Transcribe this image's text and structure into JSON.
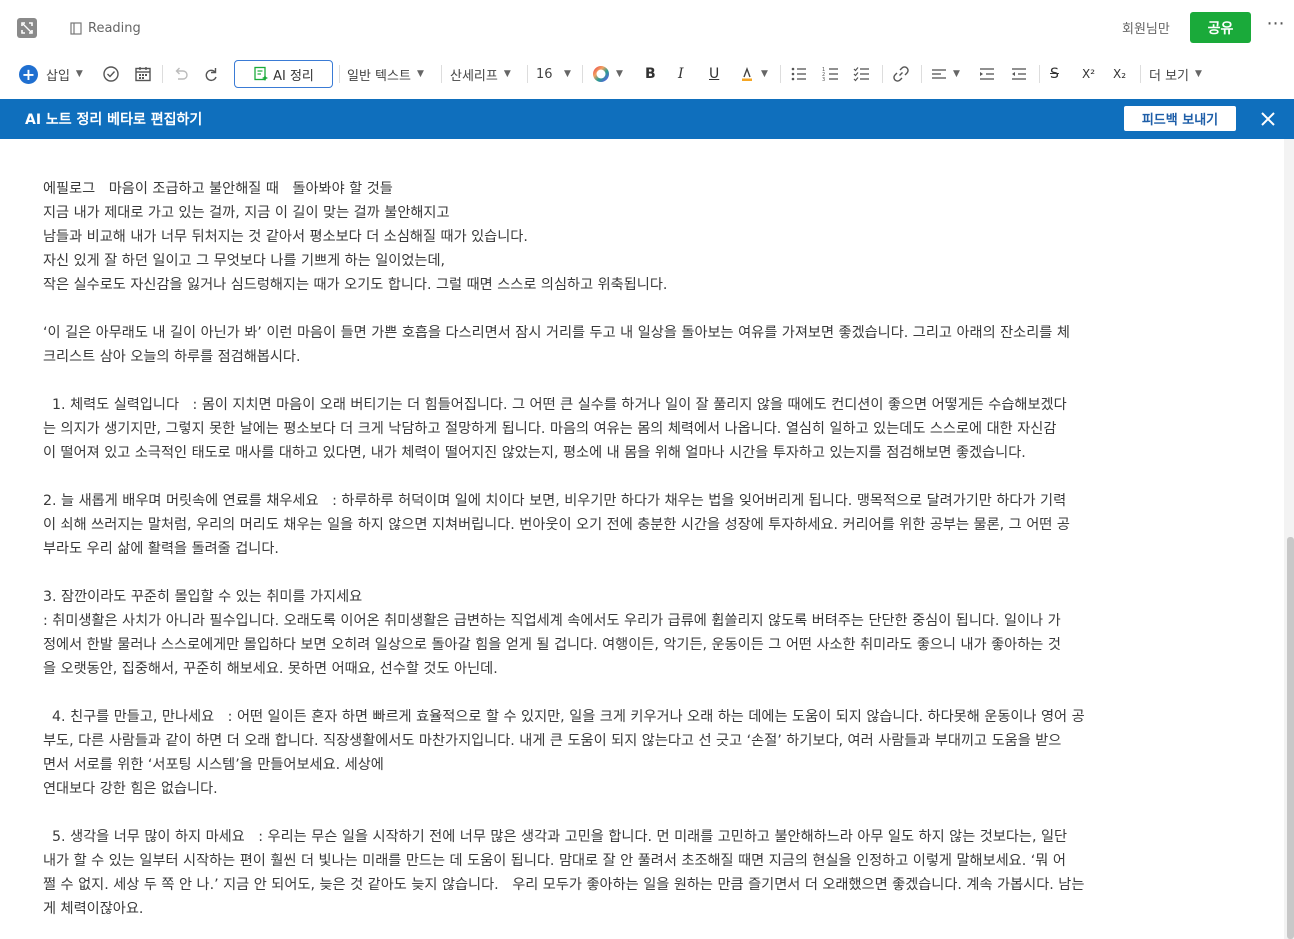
{
  "titlebar": {
    "title": "Reading",
    "members_label": "회원님만",
    "share_label": "공유",
    "more_label": "⋯"
  },
  "toolbar": {
    "insert_label": "삽입",
    "ai_label": "AI 정리",
    "text_style": "일반 텍스트",
    "font": "산세리프",
    "font_size": "16",
    "bold": "B",
    "italic": "I",
    "underline": "U",
    "strikethrough": "S",
    "superscript": "X²",
    "subscript": "X₂",
    "more_label": "더 보기",
    "accent_color": "#1f6fd0"
  },
  "banner": {
    "title": "AI 노트 정리 베타로 편집하기",
    "feedback_label": "피드백 보내기",
    "background_color": "#0f6fbd"
  },
  "content": {
    "lines": [
      "에필로그   마음이 조급하고 불안해질 때   돌아봐야 할 것들",
      "지금 내가 제대로 가고 있는 걸까, 지금 이 길이 맞는 걸까 불안해지고",
      "남들과 비교해 내가 너무 뒤처지는 것 같아서 평소보다 더 소심해질 때가 있습니다.",
      "자신 있게 잘 하던 일이고 그 무엇보다 나를 기쁘게 하는 일이었는데,",
      "작은 실수로도 자신감을 잃거나 심드렁해지는 때가 오기도 합니다. 그럴 때면 스스로 의심하고 위축됩니다.",
      "‘이 길은 아무래도 내 길이 아닌가 봐’ 이런 마음이 들면 가쁜 호흡을 다스리면서 잠시 거리를 두고 내 일상을 돌아보는 여유를 가져보면 좋겠습니다. 그리고 아래의 잔소리를 체",
      "크리스트 삼아 오늘의 하루를 점검해봅시다.",
      "  1. 체력도 실력입니다   : 몸이 지치면 마음이 오래 버티기는 더 힘들어집니다. 그 어떤 큰 실수를 하거나 일이 잘 풀리지 않을 때에도 컨디션이 좋으면 어떻게든 수습해보겠다",
      "는 의지가 생기지만, 그렇지 못한 날에는 평소보다 더 크게 낙담하고 절망하게 됩니다. 마음의 여유는 몸의 체력에서 나옵니다. 열심히 일하고 있는데도 스스로에 대한 자신감",
      "이 떨어져 있고 소극적인 태도로 매사를 대하고 있다면, 내가 체력이 떨어지진 않았는지, 평소에 내 몸을 위해 얼마나 시간을 투자하고 있는지를 점검해보면 좋겠습니다.",
      "2. 늘 새롭게 배우며 머릿속에 연료를 채우세요   : 하루하루 허덕이며 일에 치이다 보면, 비우기만 하다가 채우는 법을 잊어버리게 됩니다. 맹목적으로 달려가기만 하다가 기력",
      "이 쇠해 쓰러지는 말처럼, 우리의 머리도 채우는 일을 하지 않으면 지쳐버립니다. 번아웃이 오기 전에 충분한 시간을 성장에 투자하세요. 커리어를 위한 공부는 물론, 그 어떤 공",
      "부라도 우리 삶에 활력을 돌려줄 겁니다.",
      "3. 잠깐이라도 꾸준히 몰입할 수 있는 취미를 가지세요",
      ": 취미생활은 사치가 아니라 필수입니다. 오래도록 이어온 취미생활은 급변하는 직업세계 속에서도 우리가 급류에 휩쓸리지 않도록 버텨주는 단단한 중심이 됩니다. 일이나 가",
      "정에서 한발 물러나 스스로에게만 몰입하다 보면 오히려 일상으로 돌아갈 힘을 얻게 될 겁니다. 여행이든, 악기든, 운동이든 그 어떤 사소한 취미라도 좋으니 내가 좋아하는 것",
      "을 오랫동안, 집중해서, 꾸준히 해보세요. 못하면 어때요, 선수할 것도 아닌데.",
      "  4. 친구를 만들고, 만나세요   : 어떤 일이든 혼자 하면 빠르게 효율적으로 할 수 있지만, 일을 크게 키우거나 오래 하는 데에는 도움이 되지 않습니다. 하다못해 운동이나 영어 공",
      "부도, 다른 사람들과 같이 하면 더 오래 합니다. 직장생활에서도 마찬가지입니다. 내게 큰 도움이 되지 않는다고 선 긋고 ‘손절’ 하기보다, 여러 사람들과 부대끼고 도움을 받으",
      "면서 서로를 위한 ‘서포팅 시스템’을 만들어보세요. 세상에",
      "연대보다 강한 힘은 없습니다.",
      "  5. 생각을 너무 많이 하지 마세요   : 우리는 무슨 일을 시작하기 전에 너무 많은 생각과 고민을 합니다. 먼 미래를 고민하고 불안해하느라 아무 일도 하지 않는 것보다는, 일단",
      "내가 할 수 있는 일부터 시작하는 편이 훨씬 더 빛나는 미래를 만드는 데 도움이 됩니다. 맘대로 잘 안 풀려서 초조해질 때면 지금의 현실을 인정하고 이렇게 말해보세요. ‘뭐 어",
      "쩔 수 없지. 세상 두 쪽 안 나.’ 지금 안 되어도, 늦은 것 같아도 늦지 않습니다.   우리 모두가 좋아하는 일을 원하는 만큼 즐기면서 더 오래했으면 좋겠습니다. 계속 가봅시다. 남는",
      "게 체력이잖아요."
    ]
  }
}
